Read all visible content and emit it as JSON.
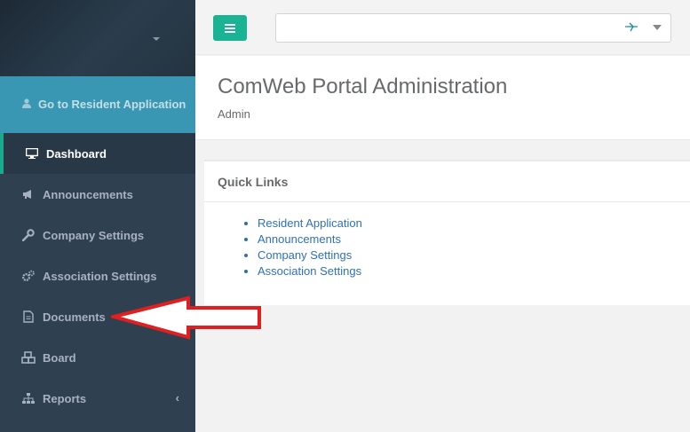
{
  "sidebar": {
    "resident_link": "Go to Resident Application",
    "items": [
      {
        "label": "Dashboard",
        "icon": "monitor-icon",
        "active": true
      },
      {
        "label": "Announcements",
        "icon": "bullhorn-icon"
      },
      {
        "label": "Company Settings",
        "icon": "wrench-icon"
      },
      {
        "label": "Association Settings",
        "icon": "gears-icon"
      },
      {
        "label": "Documents",
        "icon": "file-icon"
      },
      {
        "label": "Board",
        "icon": "cubes-icon"
      },
      {
        "label": "Reports",
        "icon": "sitemap-icon",
        "chevron": "‹"
      }
    ]
  },
  "header": {
    "title": "ComWeb Portal Administration",
    "subtitle": "Admin"
  },
  "quick_links": {
    "title": "Quick Links",
    "links": [
      "Resident Application",
      "Announcements",
      "Company Settings",
      "Association Settings"
    ]
  },
  "colors": {
    "sidebar_bg": "#2f4050",
    "accent_green": "#1ab394",
    "resident_bg": "#3a97b3",
    "link_blue": "#3070b8",
    "annotation_red": "#e02020"
  }
}
